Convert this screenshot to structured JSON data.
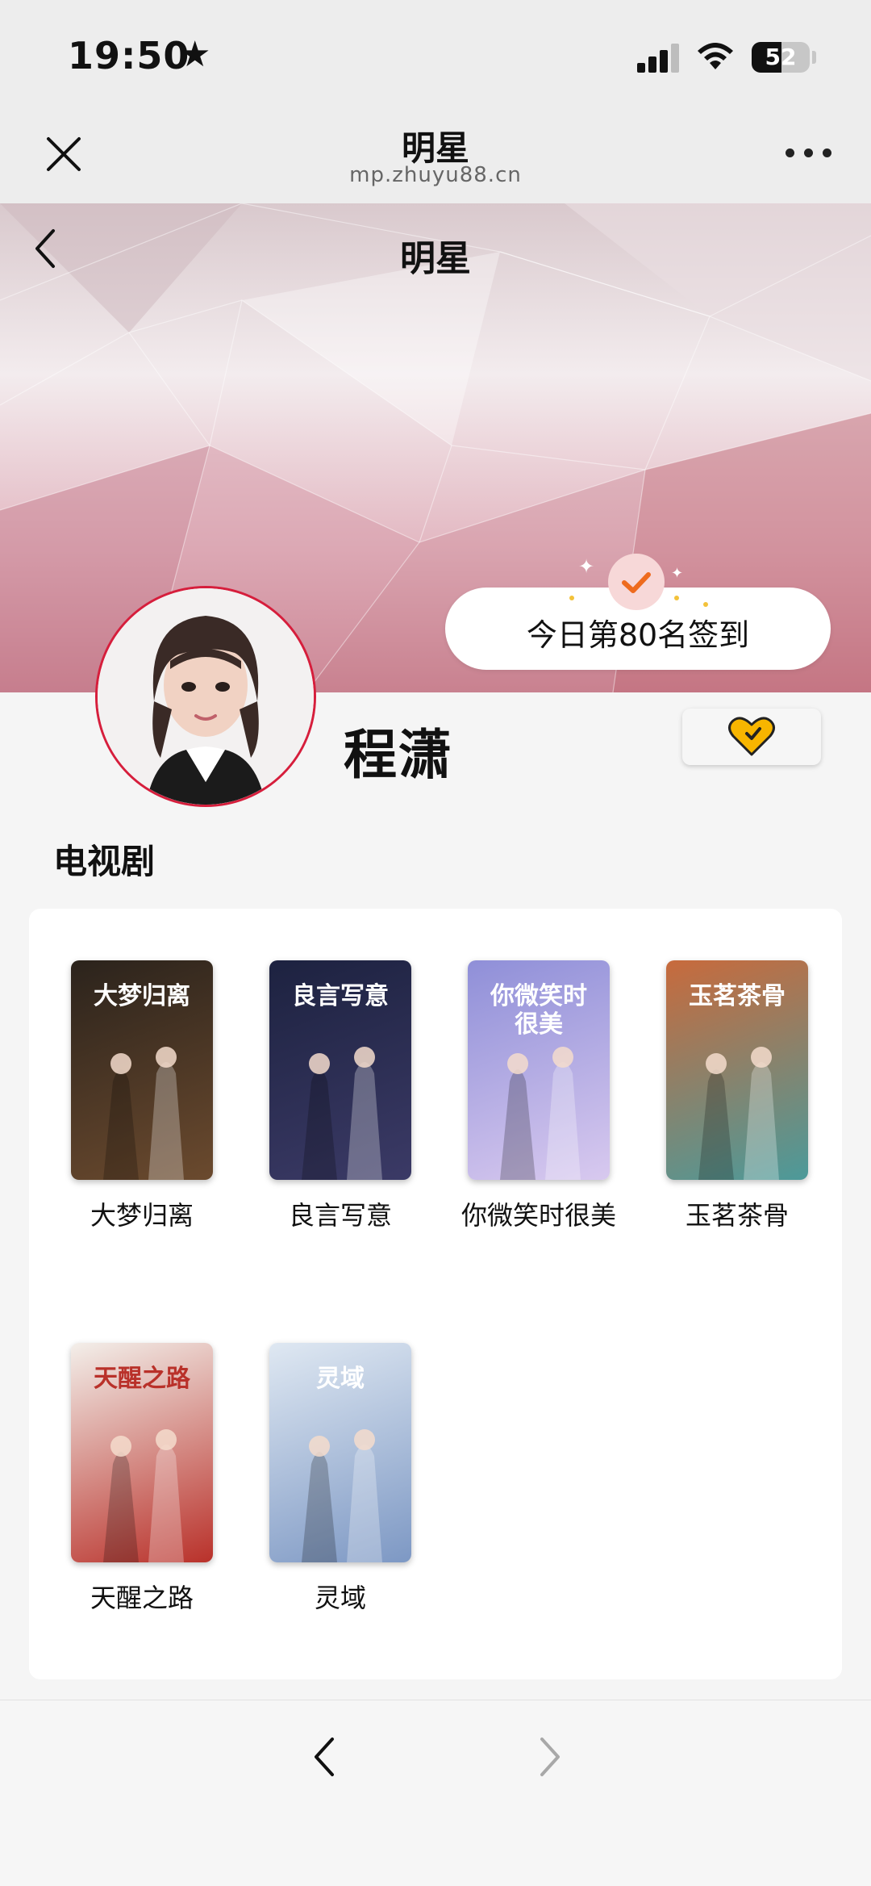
{
  "status_bar": {
    "time": "19:50",
    "battery": "52",
    "battery_level": 0.52
  },
  "mini_program": {
    "title": "明星",
    "url": "mp.zhuyu88.cn"
  },
  "header": {
    "title": "明星"
  },
  "checkin": {
    "label": "今日第80名签到"
  },
  "profile": {
    "name": "程潇"
  },
  "section": {
    "title": "电视剧"
  },
  "dramas": [
    {
      "name": "大梦归离",
      "poster_title": "大梦归离",
      "colors": [
        "#2b231c",
        "#6b4a2e"
      ]
    },
    {
      "name": "良言写意",
      "poster_title": "良言写意",
      "colors": [
        "#1d2240",
        "#3b3a66"
      ]
    },
    {
      "name": "你微笑时很美",
      "poster_title": "你微笑时很美",
      "colors": [
        "#8f8fd8",
        "#d8c9ef"
      ]
    },
    {
      "name": "玉茗茶骨",
      "poster_title": "玉茗茶骨",
      "colors": [
        "#c86a3c",
        "#4c9a9a"
      ]
    },
    {
      "name": "天醒之路",
      "poster_title": "天醒之路",
      "colors": [
        "#f3efea",
        "#b9312a"
      ]
    },
    {
      "name": "灵域",
      "poster_title": "灵域",
      "colors": [
        "#dfe8f2",
        "#7d98c4"
      ]
    }
  ],
  "colors": {
    "accent_red": "#d61e3c",
    "heart_yellow": "#f7b500",
    "check_orange": "#ee6b1e"
  }
}
